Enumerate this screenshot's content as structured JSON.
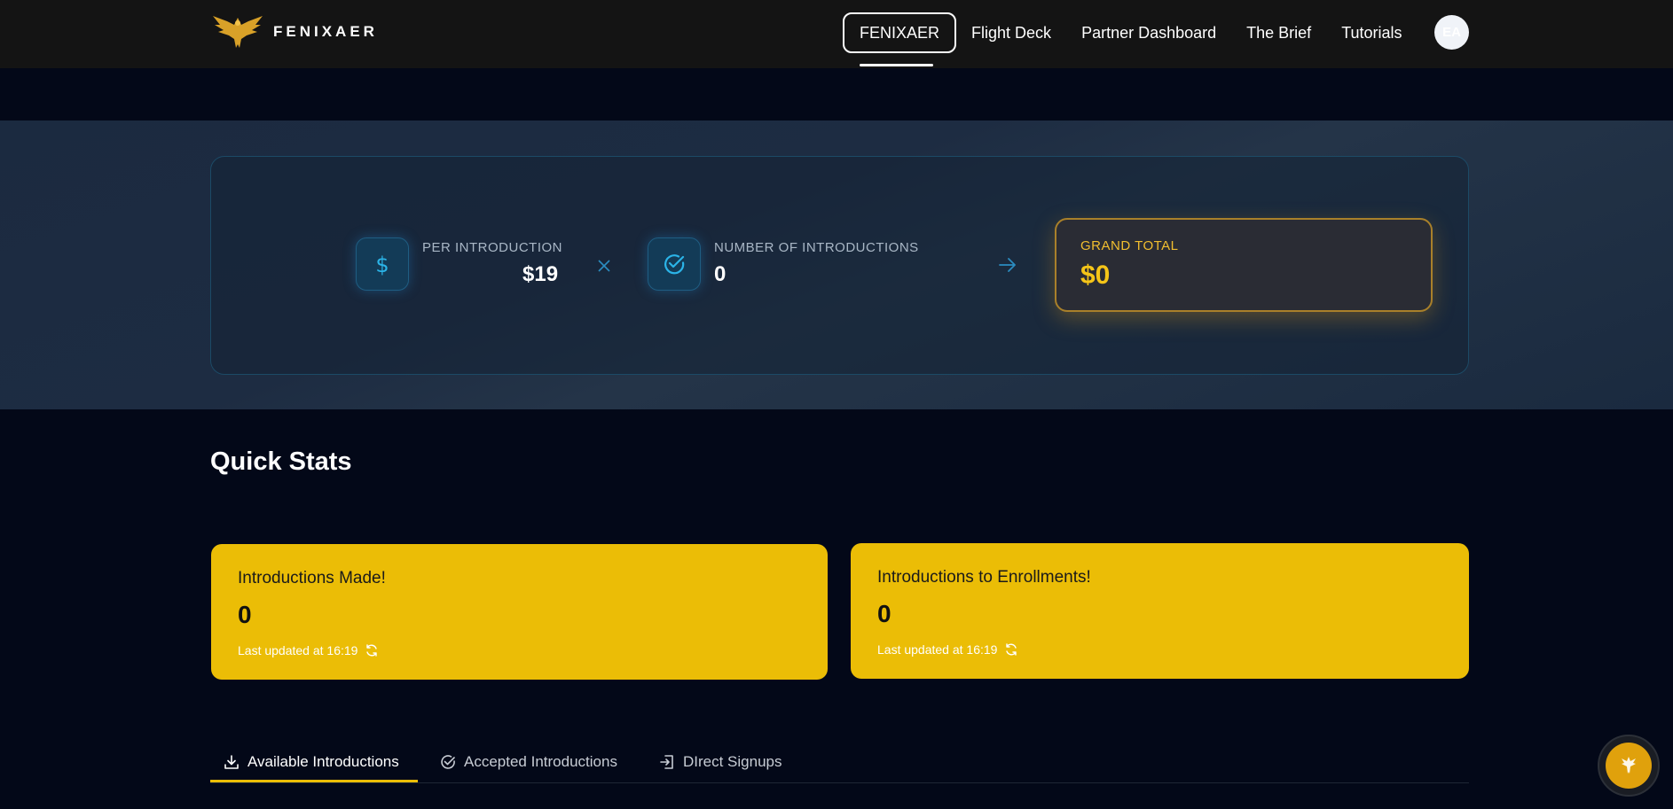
{
  "brand": {
    "name": "FENIXAER"
  },
  "nav": {
    "items": [
      {
        "label": "FENIXAER"
      },
      {
        "label": "Flight Deck"
      },
      {
        "label": "Partner Dashboard"
      },
      {
        "label": "The Brief"
      },
      {
        "label": "Tutorials"
      }
    ],
    "avatar_initials": "EA"
  },
  "calculator": {
    "per_intro_label": "PER INTRODUCTION",
    "per_intro_value": "$19",
    "num_intro_label": "NUMBER OF INTRODUCTIONS",
    "num_intro_value": "0",
    "grand_label": "GRAND TOTAL",
    "grand_value": "$0"
  },
  "quick_stats": {
    "title": "Quick Stats",
    "cards": [
      {
        "title": "Introductions Made!",
        "value": "0",
        "updated": "Last updated at 16:19"
      },
      {
        "title": "Introductions to Enrollments!",
        "value": "0",
        "updated": "Last updated at 16:19"
      }
    ]
  },
  "tabs": [
    {
      "label": "Available Introductions",
      "icon": "download-icon"
    },
    {
      "label": "Accepted Introductions",
      "icon": "check-circle-icon"
    },
    {
      "label": "DIrect Signups",
      "icon": "sign-in-icon"
    }
  ],
  "colors": {
    "accent_yellow": "#ebbd06",
    "gold": "#f5c518",
    "cyan": "#2bb4e8",
    "background": "#030818"
  }
}
